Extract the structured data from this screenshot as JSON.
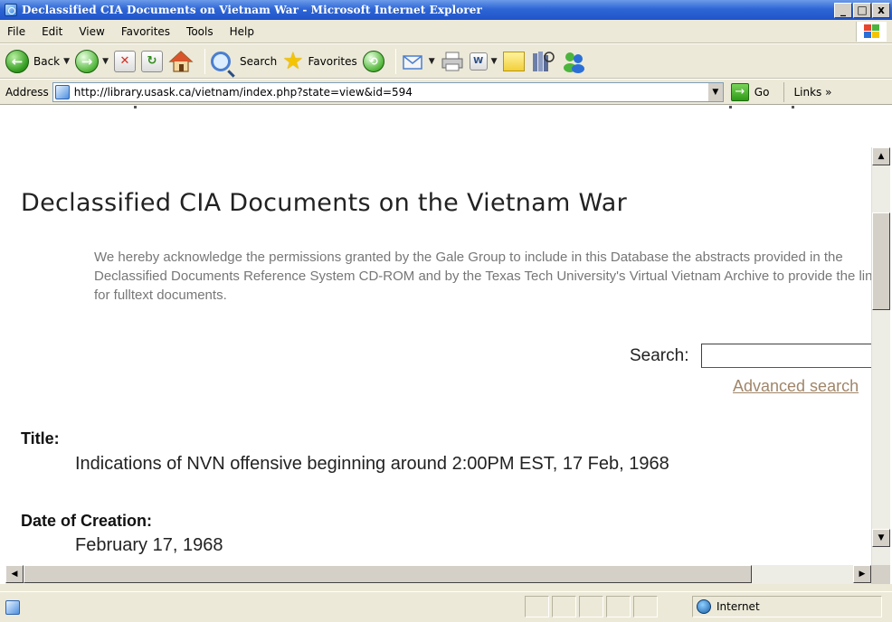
{
  "window": {
    "title": "Declassified CIA Documents on Vietnam War - Microsoft Internet Explorer",
    "controls": [
      "_",
      "□",
      "x"
    ]
  },
  "menu": {
    "items": [
      "File",
      "Edit",
      "View",
      "Favorites",
      "Tools",
      "Help"
    ]
  },
  "toolbar": {
    "back_label": "Back",
    "search_label": "Search",
    "favorites_label": "Favorites"
  },
  "address": {
    "label": "Address",
    "url": "http://library.usask.ca/vietnam/index.php?state=view&id=594",
    "go_label": "Go",
    "links_label": "Links »"
  },
  "page": {
    "title": "Declassified CIA Documents on the Vietnam War",
    "acknowledgement": "We hereby acknowledge the permissions granted by the Gale Group to include in this Database the abstracts provided in the Declassified Documents Reference System CD-ROM and by the Texas Tech University's Virtual Vietnam Archive to provide the links for fulltext documents.",
    "search_label": "Search:",
    "search_value": "",
    "advanced_search_label": "Advanced search",
    "fields": [
      {
        "label": "Title:",
        "value": "Indications of NVN offensive beginning around 2:00PM EST, 17 Feb, 1968"
      },
      {
        "label": "Date of Creation:",
        "value": "February 17, 1968"
      }
    ]
  },
  "status": {
    "zone_label": "Internet"
  },
  "colors": {
    "titlebar": "#2f66d6",
    "chrome": "#ece9d8",
    "link": "#a0866a",
    "ack_text": "#777777"
  }
}
